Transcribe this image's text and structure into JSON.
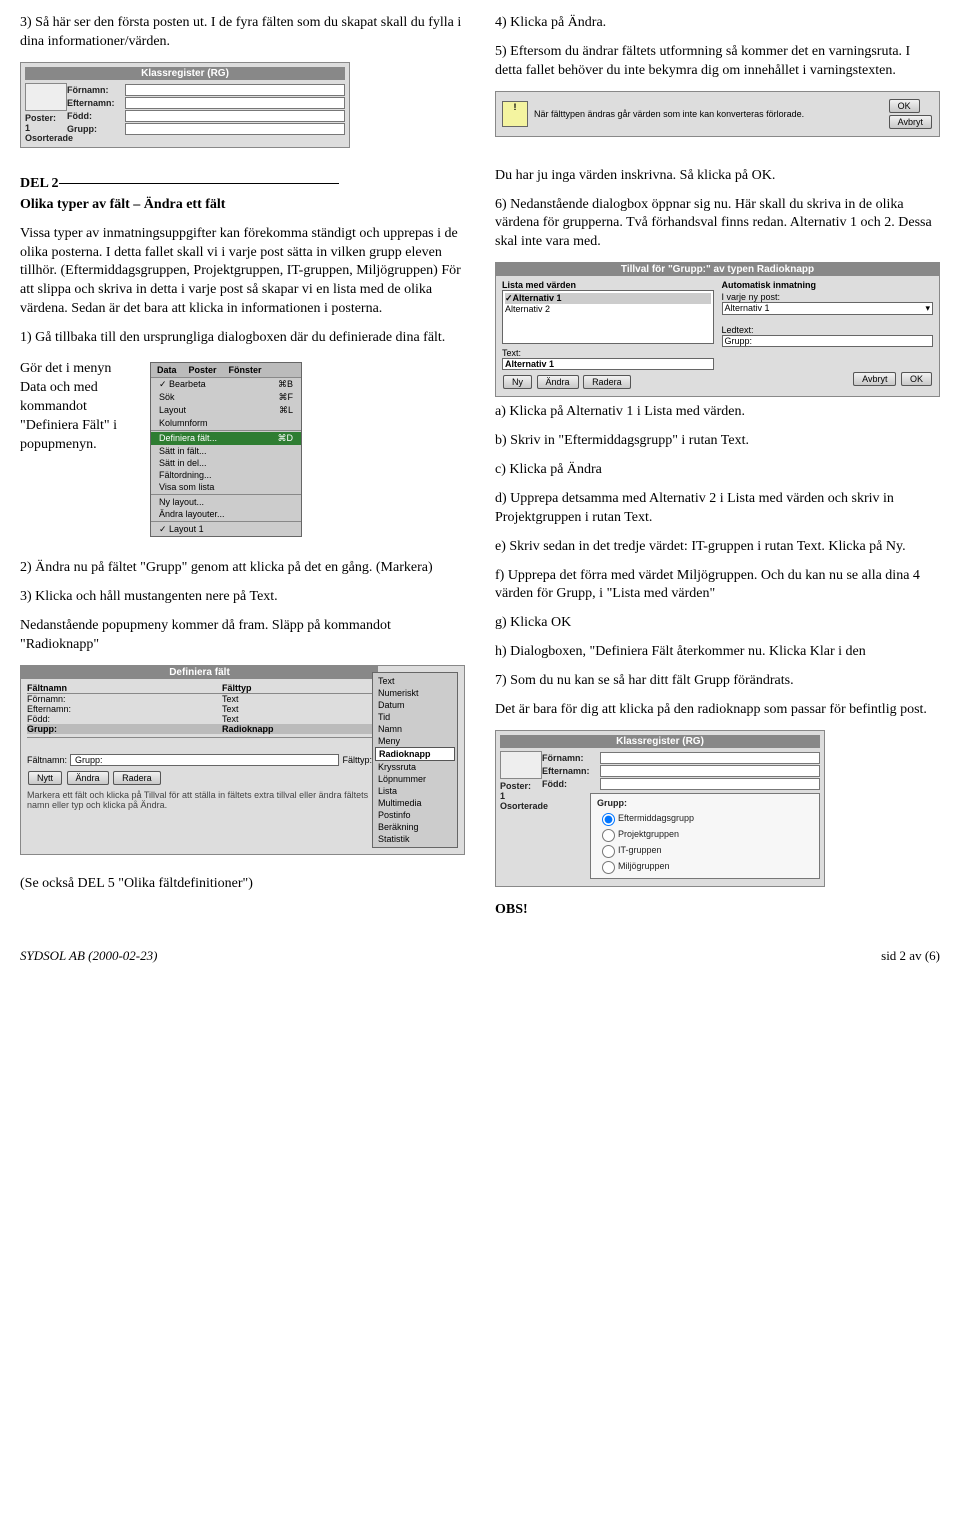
{
  "left": {
    "p1": "3) Så här ser den första posten ut. I de fyra fälten som du skapat skall du fylla i dina informationer/värden.",
    "ss1": {
      "title": "Klassregister (RG)",
      "f1": "Förnamn:",
      "f2": "Efternamn:",
      "f3": "Född:",
      "f4": "Grupp:",
      "poster": "Poster:",
      "poster_v": "1",
      "osort": "Osorterade"
    },
    "del2": "DEL 2",
    "del2_sub": "Olika typer av fält – Ändra ett fält",
    "p2": "Vissa typer av inmatningsuppgifter kan förekomma ständigt och upprepas i de olika posterna. I detta fallet skall vi i varje post sätta in vilken grupp eleven tillhör. (Eftermiddagsgruppen, Projektgruppen, IT-gruppen, Miljögruppen) För att slippa och skriva in detta i varje post så skapar vi en lista med de olika värdena. Sedan är det bara att klicka in informationen i posterna.",
    "p3": "1) Gå tillbaka till den ursprungliga dialogboxen där du definierade dina fält.",
    "p4": "Gör det i menyn Data och med kommandot \"Definiera Fält\" i popupmenyn.",
    "menu": {
      "top": [
        "Data",
        "Poster",
        "Fönster"
      ],
      "items": [
        {
          "t": "Bearbeta",
          "s": "⌘B",
          "chk": true
        },
        {
          "t": "Sök",
          "s": "⌘F"
        },
        {
          "t": "Layout",
          "s": "⌘L"
        },
        {
          "t": "Kolumnform",
          "s": ""
        }
      ],
      "sel": {
        "t": "Definiera fält...",
        "s": "⌘D"
      },
      "items2": [
        {
          "t": "Sätt in fält...",
          "s": ""
        },
        {
          "t": "Sätt in del...",
          "s": ""
        },
        {
          "t": "Fältordning...",
          "s": ""
        },
        {
          "t": "Visa som lista",
          "s": ""
        }
      ],
      "items3": [
        {
          "t": "Ny layout...",
          "s": ""
        },
        {
          "t": "Ändra layouter...",
          "s": ""
        }
      ],
      "items4": [
        {
          "t": "Layout 1",
          "s": "",
          "chk": true
        }
      ]
    },
    "p5": "2) Ändra nu på fältet \"Grupp\" genom att klicka på det en gång. (Markera)",
    "p5_tail": "ång. (Markera)",
    "p6": "3) Klicka och håll mustangenten nere på Text.",
    "p7": "Nedanstående popupmeny kommer då fram. Släpp på kommandot \"Radioknapp\"",
    "def": {
      "title": "Definiera fält",
      "colh1": "Fältnamn",
      "colh2": "Fälttyp",
      "rows": [
        [
          "Förnamn:",
          "Text"
        ],
        [
          "Efternamn:",
          "Text"
        ],
        [
          "Född:",
          "Text"
        ],
        [
          "Grupp:",
          "Radioknapp"
        ]
      ],
      "faltnamn_l": "Fältnamn:",
      "faltnamn_v": "Grupp:",
      "falttyp_l": "Fälttyp:",
      "nytt": "Nytt",
      "andra": "Ändra",
      "radera": "Radera",
      "hint": "Markera ett fält och klicka på Tillval för att ställa in fältets extra tillval eller ändra fältets namn eller typ och klicka på Ändra.",
      "popup": [
        "Text",
        "Numeriskt",
        "Datum",
        "Tid",
        "Namn",
        "Meny",
        "Radioknapp",
        "Kryssruta",
        "Löpnummer",
        "Lista",
        "Multimedia",
        "Postinfo",
        "Beräkning",
        "Statistik"
      ],
      "popup_sel": "Radioknapp"
    },
    "p8": "(Se också DEL 5 \"Olika fältdefinitioner\")",
    "footer": "SYDSOL AB (2000-02-23)"
  },
  "right": {
    "p1": "4) Klicka på Ändra.",
    "p2": "5) Eftersom du ändrar fältets utformning så kommer det en varningsruta. I detta fallet behöver du inte bekymra dig om innehållet i varningstexten.",
    "warn": {
      "msg": "När fälttypen ändras går värden som inte kan konverteras förlorade.",
      "ok": "OK",
      "avbryt": "Avbryt"
    },
    "p3": "Du har ju inga värden inskrivna. Så klicka på OK.",
    "p4": "6) Nedanstående dialogbox öppnar sig nu. Här skall du skriva in de olika värdena för grupperna. Två förhandsval finns redan. Alternativ 1 och 2. Dessa skal inte vara med.",
    "tillval": {
      "title": "Tillval för \"Grupp:\" av typen Radioknapp",
      "lista_h": "Lista med värden",
      "auto_h": "Automatisk inmatning",
      "alt1": "Alternativ 1",
      "alt2": "Alternativ 2",
      "ivarje": "I varje ny post:",
      "ivarje_v": "Alternativ 1",
      "ledtext": "Ledtext:",
      "ledtext_v": "Grupp:",
      "text": "Text:",
      "text_v": "Alternativ 1",
      "ny": "Ny",
      "andra": "Ändra",
      "radera": "Radera",
      "avbryt": "Avbryt",
      "ok": "OK"
    },
    "p5": "a) Klicka på Alternativ 1 i Lista med värden.",
    "p6": "b) Skriv in \"Eftermiddagsgrupp\" i rutan Text.",
    "p7": "c) Klicka på Ändra",
    "p8": "d) Upprepa detsamma med Alternativ 2 i Lista med värden och skriv in Projektgruppen i rutan Text.",
    "p9": "e) Skriv sedan in det tredje värdet: IT-gruppen i rutan Text. Klicka på Ny.",
    "p10": "f) Upprepa det förra med värdet Miljögruppen. Och du kan nu se alla dina 4 värden för Grupp, i \"Lista med värden\"",
    "p10b": "g) Klicka OK",
    "p11": "h) Dialogboxen, \"Definiera Fält återkommer nu. Klicka Klar i den",
    "p12": "7) Som du nu kan se så har ditt fält Grupp förändrats.",
    "p13": "Det är bara för dig att klicka på den radioknapp som passar för befintlig post.",
    "ss2": {
      "title": "Klassregister (RG)",
      "f1": "Förnamn:",
      "f2": "Efternamn:",
      "f3": "Född:",
      "grp": "Grupp:",
      "radios": [
        "Eftermiddagsgrupp",
        "Projektgruppen",
        "IT-gruppen",
        "Miljögruppen"
      ],
      "poster": "Poster:",
      "poster_v": "1",
      "osort": "Osorterade"
    },
    "obs": "OBS!",
    "footer": "sid 2 av (6)"
  }
}
